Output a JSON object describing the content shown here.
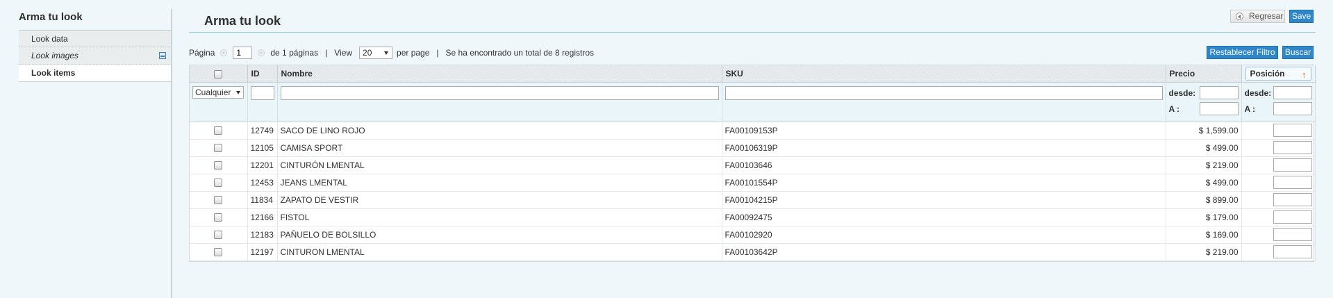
{
  "sidebar": {
    "title": "Arma tu look",
    "items": [
      {
        "label": "Look data"
      },
      {
        "label": "Look images"
      },
      {
        "label": "Look items"
      }
    ]
  },
  "header": {
    "title": "Arma tu look",
    "back_label": "Regresar",
    "save_label": "Save"
  },
  "pager": {
    "page_label": "Página",
    "page_value": "1",
    "of_pages": "de 1 páginas",
    "view_label": "View",
    "per_page_value": "20",
    "per_page_label": "per page",
    "total_text": "Se ha encontrado un total de 8 registros",
    "sep": "|"
  },
  "actions": {
    "reset_label": "Restablecer Filtro",
    "search_label": "Buscar"
  },
  "grid": {
    "columns": {
      "id": "ID",
      "name": "Nombre",
      "sku": "SKU",
      "price": "Precio",
      "position": "Posición"
    },
    "filter": {
      "any_option": "Cualquier",
      "from_label": "desde:",
      "to_label": "A :"
    },
    "rows": [
      {
        "id": "12749",
        "name": "SACO DE LINO ROJO",
        "sku": "FA00109153P",
        "price": "$ 1,599.00"
      },
      {
        "id": "12105",
        "name": "CAMISA SPORT",
        "sku": "FA00106319P",
        "price": "$ 499.00"
      },
      {
        "id": "12201",
        "name": "CINTURÓN LMENTAL",
        "sku": "FA00103646",
        "price": "$ 219.00"
      },
      {
        "id": "12453",
        "name": "JEANS LMENTAL",
        "sku": "FA00101554P",
        "price": "$ 499.00"
      },
      {
        "id": "11834",
        "name": "ZAPATO DE VESTIR",
        "sku": "FA00104215P",
        "price": "$ 899.00"
      },
      {
        "id": "12166",
        "name": "FISTOL",
        "sku": "FA00092475",
        "price": "$ 179.00"
      },
      {
        "id": "12183",
        "name": "PAÑUELO DE BOLSILLO",
        "sku": "FA00102920",
        "price": "$ 169.00"
      },
      {
        "id": "12197",
        "name": "CINTURON LMENTAL",
        "sku": "FA00103642P",
        "price": "$ 219.00"
      }
    ]
  },
  "colors": {
    "accent": "#2f86c8",
    "page_bg": "#f0f7fa",
    "sort_arrow": "#e25b1d"
  },
  "icons": {
    "save": "save-icon",
    "back": "back-arrow-icon",
    "sort": "sort-ascending-icon"
  }
}
